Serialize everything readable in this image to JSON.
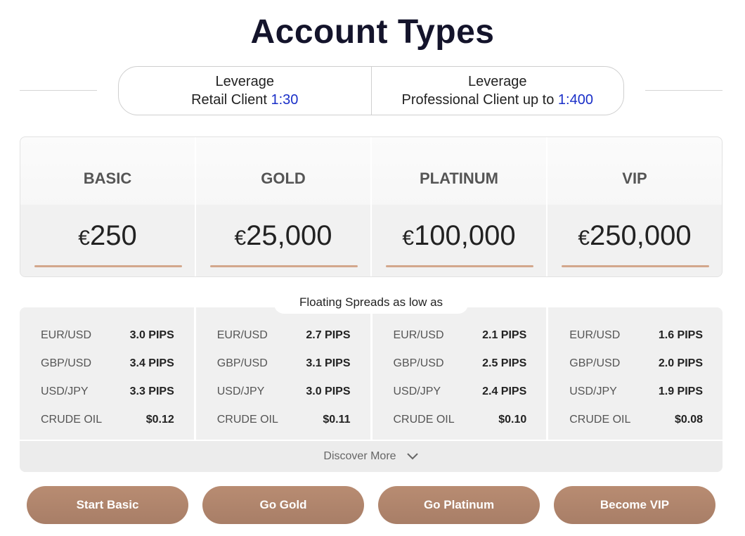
{
  "title": "Account Types",
  "leverage": [
    {
      "heading": "Leverage",
      "label": "Retail Client",
      "value": "1:30"
    },
    {
      "heading": "Leverage",
      "label": "Professional Client up to",
      "value": "1:400"
    }
  ],
  "tiers": [
    {
      "name": "BASIC",
      "currency": "€",
      "amount": "250",
      "button": "Start Basic"
    },
    {
      "name": "GOLD",
      "currency": "€",
      "amount": "25,000",
      "button": "Go Gold"
    },
    {
      "name": "PLATINUM",
      "currency": "€",
      "amount": "100,000",
      "button": "Go Platinum"
    },
    {
      "name": "VIP",
      "currency": "€",
      "amount": "250,000",
      "button": "Become VIP"
    }
  ],
  "spreads_label": "Floating Spreads as low as",
  "spreads": [
    [
      {
        "pair": "EUR/USD",
        "value": "3.0 PIPS"
      },
      {
        "pair": "GBP/USD",
        "value": "3.4 PIPS"
      },
      {
        "pair": "USD/JPY",
        "value": "3.3 PIPS"
      },
      {
        "pair": "CRUDE OIL",
        "value": "$0.12"
      }
    ],
    [
      {
        "pair": "EUR/USD",
        "value": "2.7 PIPS"
      },
      {
        "pair": "GBP/USD",
        "value": "3.1 PIPS"
      },
      {
        "pair": "USD/JPY",
        "value": "3.0 PIPS"
      },
      {
        "pair": "CRUDE OIL",
        "value": "$0.11"
      }
    ],
    [
      {
        "pair": "EUR/USD",
        "value": "2.1 PIPS"
      },
      {
        "pair": "GBP/USD",
        "value": "2.5 PIPS"
      },
      {
        "pair": "USD/JPY",
        "value": "2.4 PIPS"
      },
      {
        "pair": "CRUDE OIL",
        "value": "$0.10"
      }
    ],
    [
      {
        "pair": "EUR/USD",
        "value": "1.6 PIPS"
      },
      {
        "pair": "GBP/USD",
        "value": "2.0 PIPS"
      },
      {
        "pair": "USD/JPY",
        "value": "1.9 PIPS"
      },
      {
        "pair": "CRUDE OIL",
        "value": "$0.08"
      }
    ]
  ],
  "discover_label": "Discover More",
  "colors": {
    "accent": "#d3a78c",
    "button": "#b08570",
    "leverage_value": "#1a2fc8",
    "title": "#14142b"
  }
}
